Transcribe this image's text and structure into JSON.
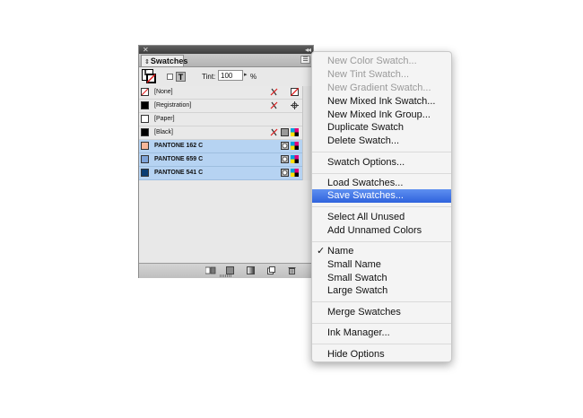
{
  "panel": {
    "tab_label": "Swatches",
    "tint_label": "Tint:",
    "tint_value": "100",
    "tint_unit": "%",
    "swatches": [
      {
        "name": "[None]",
        "color": "#ffffff",
        "selected": false,
        "bold": false
      },
      {
        "name": "[Registration]",
        "color": "#000000",
        "selected": false,
        "bold": false
      },
      {
        "name": "[Paper]",
        "color": "#ffffff",
        "selected": false,
        "bold": false
      },
      {
        "name": "[Black]",
        "color": "#000000",
        "selected": false,
        "bold": false
      },
      {
        "name": "PANTONE 162 C",
        "color": "#f6b79a",
        "selected": true,
        "bold": true
      },
      {
        "name": "PANTONE 659 C",
        "color": "#7ea3d8",
        "selected": true,
        "bold": true
      },
      {
        "name": "PANTONE 541 C",
        "color": "#0b3d73",
        "selected": true,
        "bold": true
      }
    ]
  },
  "menu": {
    "items": [
      {
        "label": "New Color Swatch...",
        "disabled": true
      },
      {
        "label": "New Tint Swatch...",
        "disabled": true
      },
      {
        "label": "New Gradient Swatch...",
        "disabled": true
      },
      {
        "label": "New Mixed Ink Swatch...",
        "disabled": false
      },
      {
        "label": "New Mixed Ink Group...",
        "disabled": false
      },
      {
        "label": "Duplicate Swatch",
        "disabled": false
      },
      {
        "label": "Delete Swatch...",
        "disabled": false
      },
      {
        "label": "Swatch Options...",
        "disabled": false
      },
      {
        "label": "Load Swatches...",
        "disabled": false
      },
      {
        "label": "Save Swatches...",
        "disabled": false,
        "highlighted": true
      },
      {
        "label": "Select All Unused",
        "disabled": false
      },
      {
        "label": "Add Unnamed Colors",
        "disabled": false
      },
      {
        "label": "Name",
        "disabled": false,
        "checked": true
      },
      {
        "label": "Small Name",
        "disabled": false
      },
      {
        "label": "Small Swatch",
        "disabled": false
      },
      {
        "label": "Large Swatch",
        "disabled": false
      },
      {
        "label": "Merge Swatches",
        "disabled": false
      },
      {
        "label": "Ink Manager...",
        "disabled": false
      },
      {
        "label": "Hide Options",
        "disabled": false
      }
    ]
  },
  "colors": {
    "menu_highlight": "#3a6fe3",
    "selected_row": "#b6d3f2"
  }
}
